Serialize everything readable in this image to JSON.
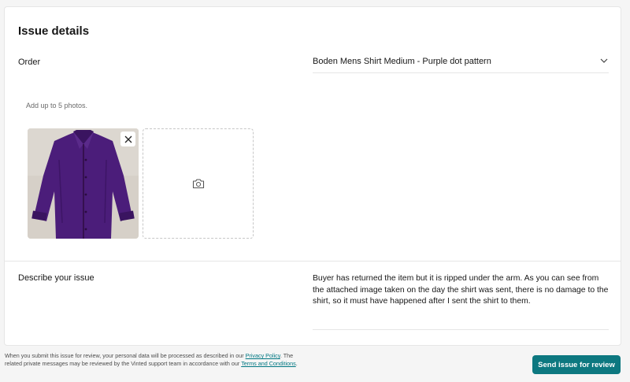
{
  "issue": {
    "title": "Issue details",
    "order_label": "Order",
    "order_value": "Boden Mens Shirt Medium - Purple dot pattern",
    "photos_hint": "Add up to 5 photos.",
    "describe_label": "Describe your issue",
    "describe_text": "Buyer has returned the item but it is ripped under the arm. As you can see from the attached image taken on the day the shirt was sent, there is no damage to the shirt, so it must have happened after I sent the shirt to them."
  },
  "footer": {
    "note_part1": "When you submit this issue for review, your personal data will be processed as described in our ",
    "privacy_link": "Privacy Policy",
    "note_part2": ". The related private messages may be reviewed by the Vinted support team in accordance with our ",
    "terms_link": "Terms and Conditions",
    "note_part3": ".",
    "send_button": "Send issue for review"
  },
  "icons": {
    "chevron": "chevron-down-icon",
    "remove": "close-icon",
    "add_photo": "camera-icon"
  },
  "colors": {
    "primary": "#0d7880",
    "link": "#007782",
    "shirt": "#4b1d7a"
  }
}
